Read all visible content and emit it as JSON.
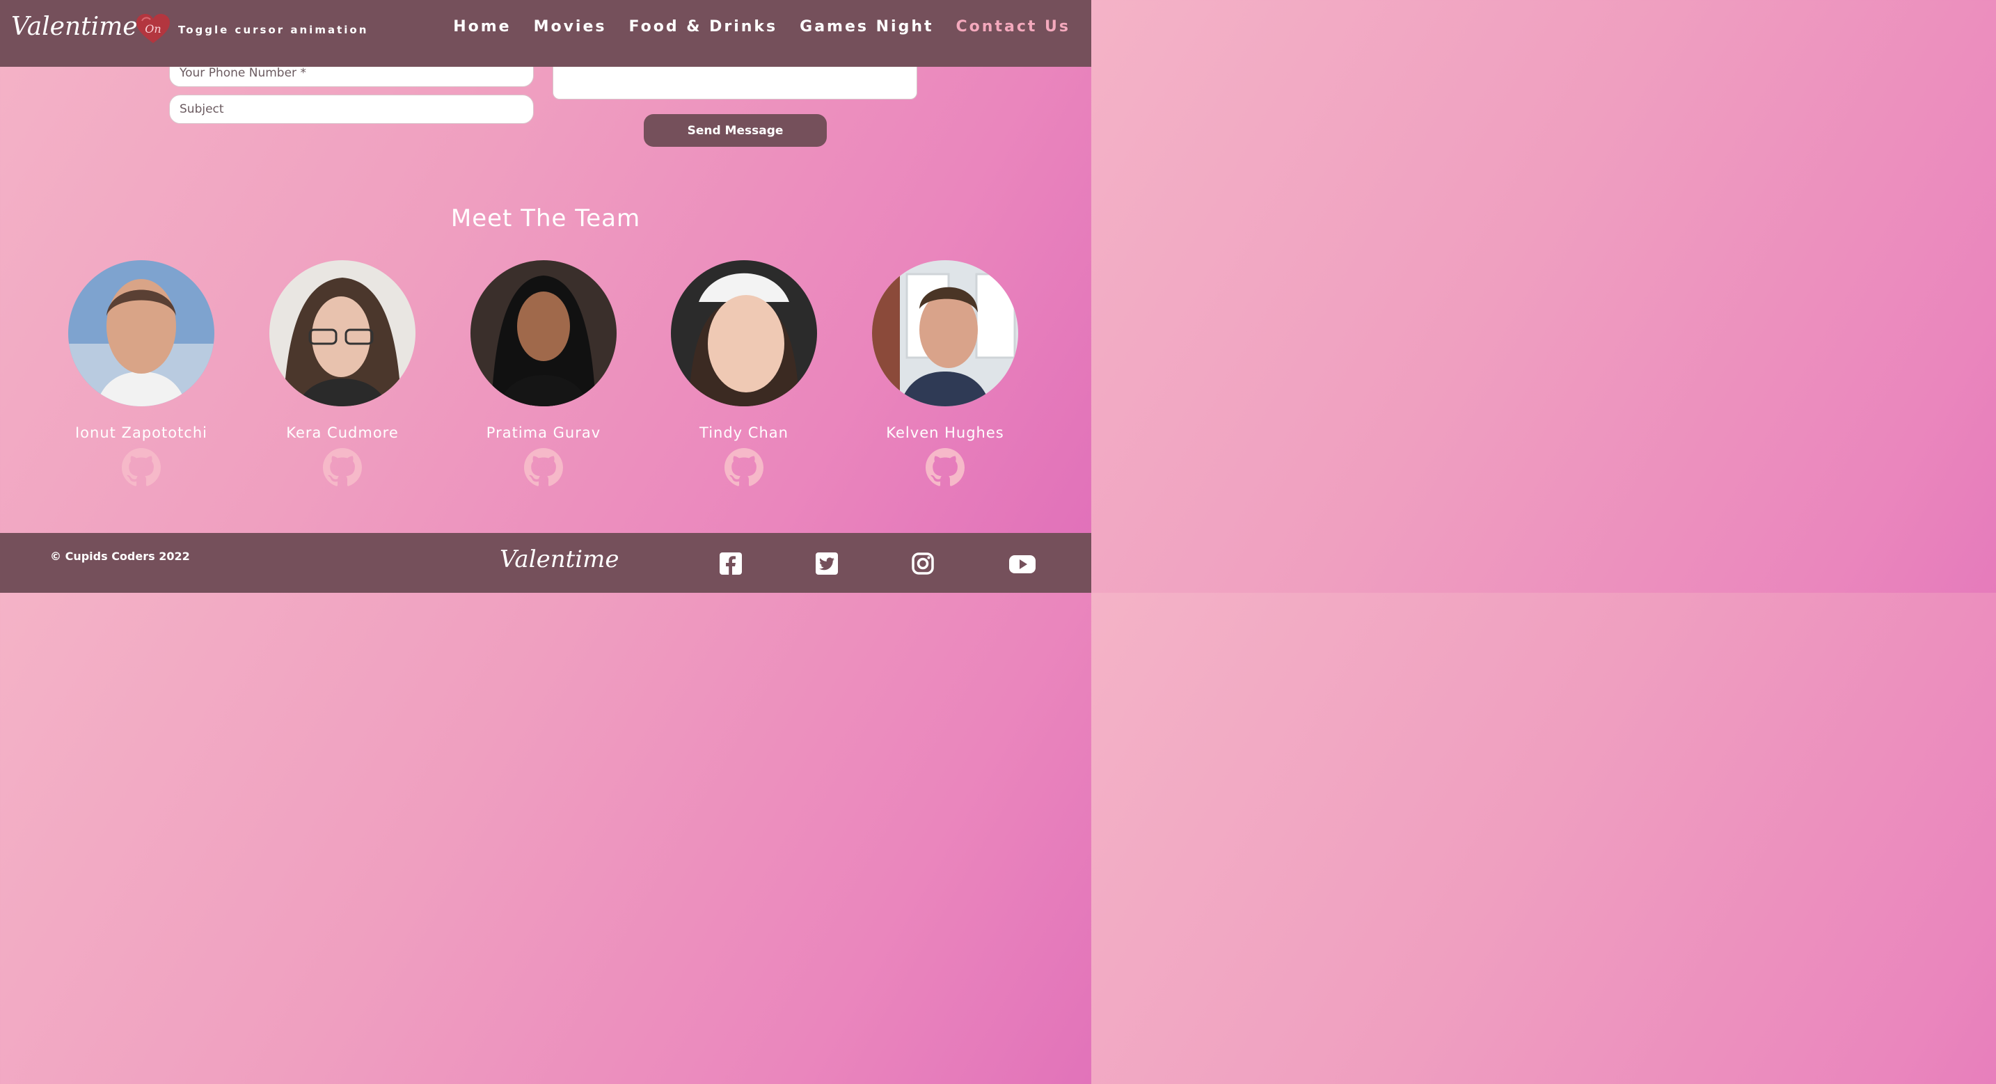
{
  "header": {
    "logo": "Valentime",
    "toggle_state": "On",
    "toggle_label": "Toggle cursor animation",
    "nav": [
      {
        "label": "Home"
      },
      {
        "label": "Movies"
      },
      {
        "label": "Food & Drinks"
      },
      {
        "label": "Games Night"
      },
      {
        "label": "Contact Us",
        "active": true
      }
    ]
  },
  "form": {
    "phone_placeholder": "Your Phone Number *",
    "subject_placeholder": "Subject",
    "message_value": "",
    "send_label": "Send Message"
  },
  "team": {
    "title": "Meet The Team",
    "members": [
      {
        "name": "Ionut Zapototchi",
        "icon": "github-icon"
      },
      {
        "name": "Kera Cudmore",
        "icon": "github-icon"
      },
      {
        "name": "Pratima Gurav",
        "icon": "github-icon"
      },
      {
        "name": "Tindy Chan",
        "icon": "github-icon"
      },
      {
        "name": "Kelven Hughes",
        "icon": "github-icon"
      }
    ]
  },
  "footer": {
    "copyright": "© Cupids Coders 2022",
    "logo": "Valentime",
    "social": [
      "facebook-icon",
      "twitter-icon",
      "instagram-icon",
      "youtube-icon"
    ]
  },
  "colors": {
    "header_bg": "#75505b",
    "accent_pink": "#f4a9bd",
    "gradient_start": "#f4b3c7",
    "gradient_end": "#e06fb9"
  }
}
